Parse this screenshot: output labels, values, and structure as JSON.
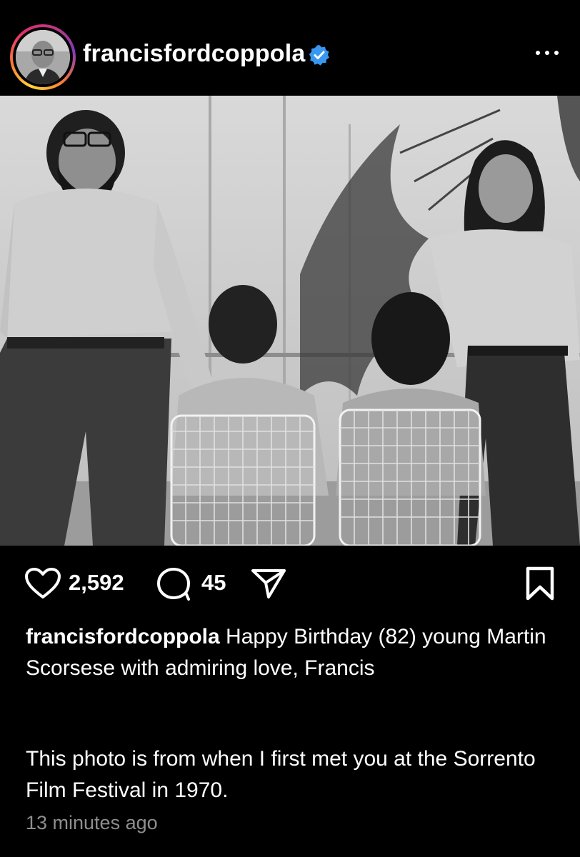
{
  "post": {
    "username": "francisfordcoppola",
    "verified": true,
    "more_icon": "more-horizontal-icon",
    "photo_description_icon": "photo-image"
  },
  "actions": {
    "like_icon": "heart-icon",
    "like_count": "2,592",
    "comment_icon": "comment-icon",
    "comment_count": "45",
    "share_icon": "send-icon",
    "save_icon": "bookmark-icon"
  },
  "caption": {
    "username": "francisfordcoppola",
    "line1": "Happy Birthday (82) young Martin Scorsese with admiring love, Francis",
    "line2": "This photo is from when I first met you at the Sorrento Film Festival in 1970."
  },
  "timestamp": "13 minutes ago",
  "colors": {
    "background": "#000000",
    "text": "#ffffff",
    "muted": "#8e8e8e",
    "verified": "#3897f0"
  }
}
